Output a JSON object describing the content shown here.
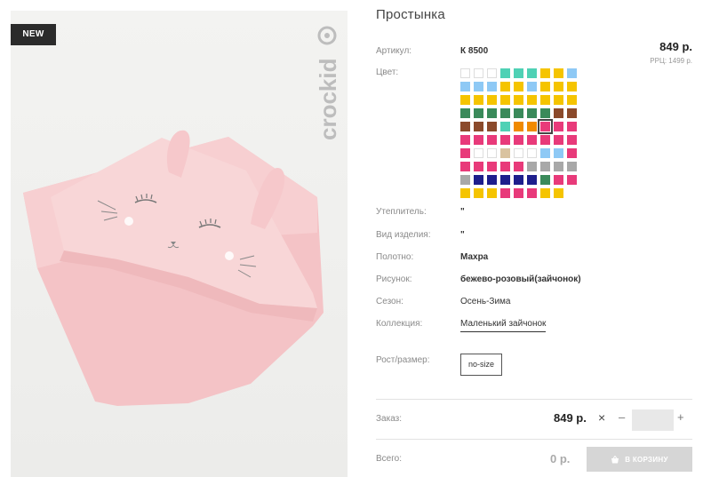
{
  "badge": "NEW",
  "brand": "crockid",
  "product": {
    "title": "Простынка",
    "article_label": "Артикул:",
    "article_value": "К 8500",
    "price": "849 р.",
    "rrp": "РРЦ: 1499 р.",
    "color_label": "Цвет:",
    "insulation_label": "Утеплитель:",
    "insulation_value": "\"",
    "type_label": "Вид изделия:",
    "type_value": "\"",
    "fabric_label": "Полотно:",
    "fabric_value": "Махра",
    "pattern_label": "Рисунок:",
    "pattern_value": "бежево-розовый(зайчонок)",
    "season_label": "Сезон:",
    "season_value": "Осень-Зима",
    "collection_label": "Коллекция:",
    "collection_value": "Маленький зайчонок",
    "size_label": "Рост/размер:",
    "size_value": "no-size"
  },
  "swatch_colors": [
    "#ffffff",
    "#ffffff",
    "#ffffff",
    "#4fd1b5",
    "#4fd1b5",
    "#4fd1b5",
    "#f5c400",
    "#f5c400",
    "#8ec9f5",
    "#8ec9f5",
    "#8ec9f5",
    "#8ec9f5",
    "#f5c400",
    "#f5c400",
    "#8ec9f5",
    "#f5c400",
    "#f5c400",
    "#f5c400",
    "#f5c400",
    "#f5c400",
    "#f5c400",
    "#f5c400",
    "#f5c400",
    "#f5c400",
    "#f5c400",
    "#f5c400",
    "#f5c400",
    "#3a8a5a",
    "#3a8a5a",
    "#3a8a5a",
    "#3a8a5a",
    "#3a8a5a",
    "#3a8a5a",
    "#3a8a5a",
    "#8b4a2b",
    "#8b4a2b",
    "#8b4a2b",
    "#8b4a2b",
    "#8b4a2b",
    "#4fd1b5",
    "#f08a00",
    "#f08a00",
    "#e83a7a",
    "#e83a7a",
    "#e83a7a",
    "#e83a7a",
    "#e83a7a",
    "#e83a7a",
    "#e83a7a",
    "#e83a7a",
    "#e83a7a",
    "#e83a7a",
    "#e83a7a",
    "#e83a7a",
    "#e83a7a",
    "#ffffff",
    "#ffffff",
    "#d9c3a0",
    "#ffffff",
    "#ffffff",
    "#8ec9f5",
    "#8ec9f5",
    "#e83a7a",
    "#e83a7a",
    "#e83a7a",
    "#e83a7a",
    "#e83a7a",
    "#e83a7a",
    "#a8a8a8",
    "#a8a8a8",
    "#a8a8a8",
    "#a8a8a8",
    "#a8a8a8",
    "#1e1e8c",
    "#1e1e8c",
    "#1e1e8c",
    "#1e1e8c",
    "#1e1e8c",
    "#3a8a5a",
    "#e83a7a",
    "#e83a7a",
    "#f5c400",
    "#f5c400",
    "#f5c400",
    "#e83a7a",
    "#e83a7a",
    "#e83a7a",
    "#f5c400",
    "#f5c400"
  ],
  "selected_swatch": 42,
  "order": {
    "label": "Заказ:",
    "price": "849 р.",
    "remove_icon": "×",
    "minus": "–",
    "quantity": "",
    "plus": "+"
  },
  "total": {
    "label": "Всего:",
    "value": "0 р.",
    "cart_button": "В КОРЗИНУ",
    "cart_icon": "basket-icon"
  },
  "colors": {
    "badge_bg": "#2b2b2b",
    "towel": "#f6c9cc",
    "cart_button_bg": "#d6d6d6"
  }
}
